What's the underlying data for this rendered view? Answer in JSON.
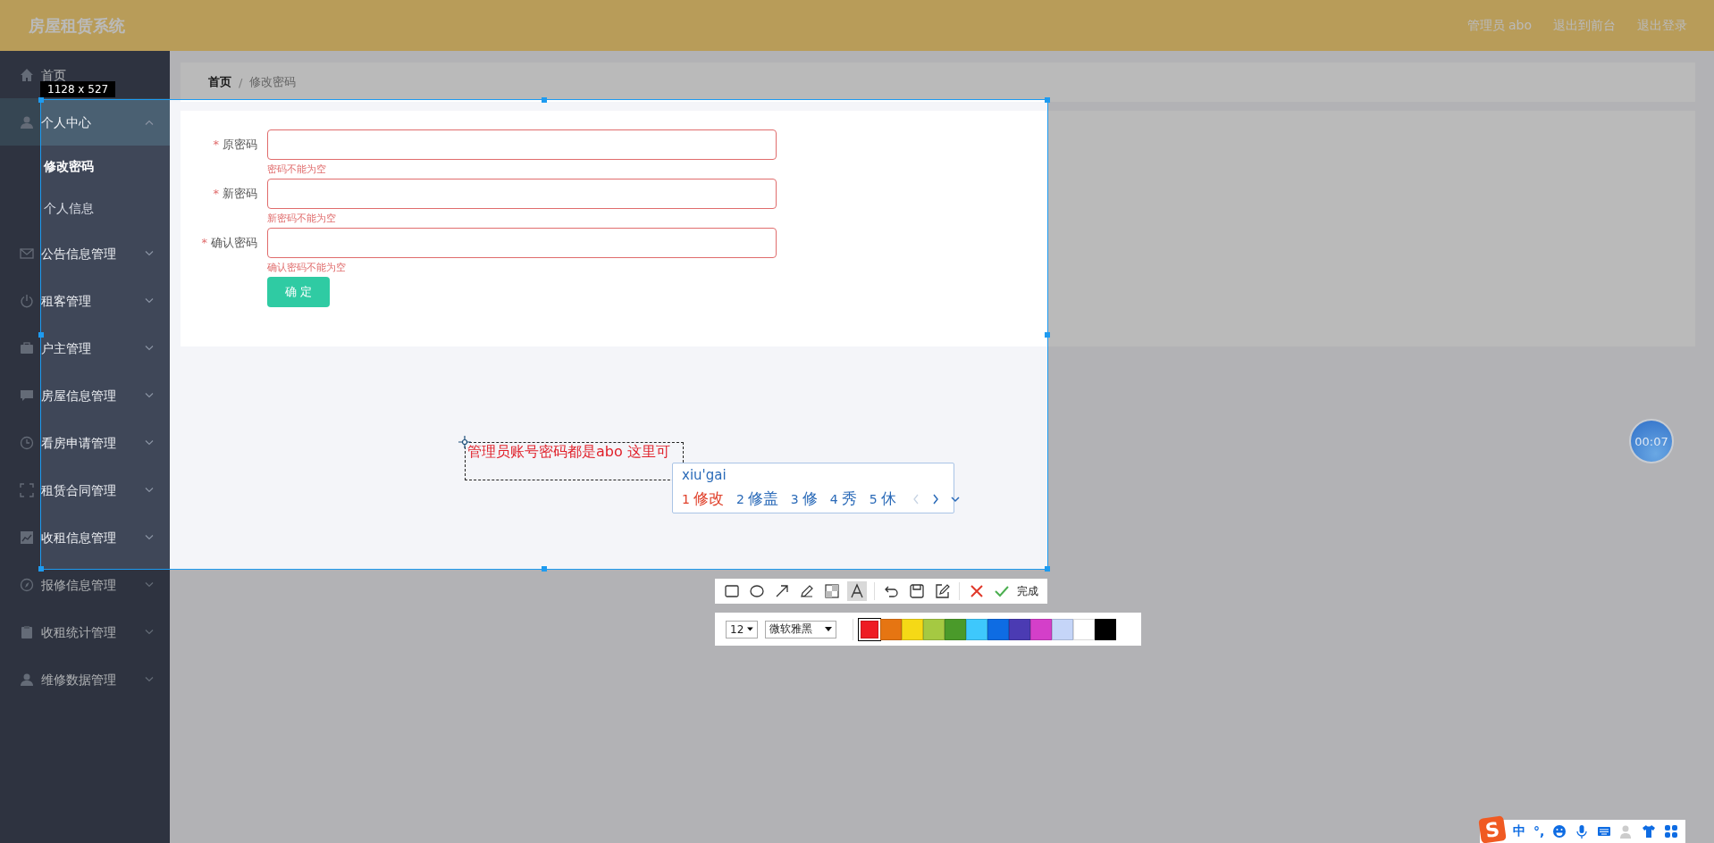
{
  "header": {
    "title": "房屋租赁系统",
    "links": [
      {
        "label": "管理员 abo"
      },
      {
        "label": "退出到前台"
      },
      {
        "label": "退出登录"
      }
    ]
  },
  "sidebar": {
    "items": [
      {
        "label": "首页"
      },
      {
        "label": "个人中心",
        "expanded": true,
        "children": [
          {
            "label": "修改密码",
            "selected": true
          },
          {
            "label": "个人信息",
            "selected": false
          }
        ]
      },
      {
        "label": "公告信息管理",
        "expanded": false
      },
      {
        "label": "租客管理",
        "expanded": false
      },
      {
        "label": "户主管理",
        "expanded": false
      },
      {
        "label": "房屋信息管理",
        "expanded": false
      },
      {
        "label": "看房申请管理",
        "expanded": false
      },
      {
        "label": "租赁合同管理",
        "expanded": false
      },
      {
        "label": "收租信息管理",
        "expanded": false
      },
      {
        "label": "报修信息管理",
        "expanded": false
      },
      {
        "label": "收租统计管理",
        "expanded": false
      },
      {
        "label": "维修数据管理",
        "expanded": false
      }
    ]
  },
  "breadcrumb": [
    {
      "label": "首页",
      "current": false,
      "kind": "link"
    },
    {
      "label": "/",
      "kind": "separator"
    },
    {
      "label": "修改密码",
      "current": true,
      "kind": "link"
    }
  ],
  "form": {
    "fields": [
      {
        "mark": "*",
        "label": "原密码",
        "invalid": true,
        "error": "密码不能为空"
      },
      {
        "mark": "*",
        "label": "新密码",
        "invalid": true,
        "error": "新密码不能为空"
      },
      {
        "mark": "*",
        "label": "确认密码",
        "invalid": true,
        "error": "确认密码不能为空"
      }
    ],
    "submit": "确 定"
  },
  "screenshot_tool": {
    "selection_size": "1128 x 527",
    "annotation": "管理员账号密码都是abo 这里可",
    "tools": [
      {
        "selected": false
      },
      {
        "selected": false
      },
      {
        "selected": false
      },
      {
        "selected": false
      },
      {
        "selected": false
      },
      {
        "selected": true
      },
      {
        "selected": false
      },
      {
        "selected": false
      },
      {
        "selected": false
      }
    ],
    "done": "完成",
    "font_size": "12",
    "font_name": "微软雅黑",
    "swatches": [
      {
        "color": "#ee1c24",
        "selected": true
      },
      {
        "color": "#e67512",
        "selected": false
      },
      {
        "color": "#f5d916",
        "selected": false
      },
      {
        "color": "#a5c942",
        "selected": false
      },
      {
        "color": "#4a9a2a",
        "selected": false
      },
      {
        "color": "#3ec8fc",
        "selected": false
      },
      {
        "color": "#0e6ce3",
        "selected": false
      },
      {
        "color": "#4b3bb3",
        "selected": false
      },
      {
        "color": "#d43fc9",
        "selected": false
      },
      {
        "color": "#c5d5f8",
        "selected": false
      },
      {
        "color": "#ffffff",
        "selected": false
      },
      {
        "color": "#000000",
        "selected": false
      }
    ]
  },
  "ime": {
    "composition": "xiu'gai",
    "candidates": [
      {
        "index": "1",
        "text": "修改",
        "selected": true
      },
      {
        "index": "2",
        "text": "修盖",
        "selected": false
      },
      {
        "index": "3",
        "text": "修",
        "selected": false
      },
      {
        "index": "4",
        "text": "秀",
        "selected": false
      },
      {
        "index": "5",
        "text": "休",
        "selected": false
      }
    ]
  },
  "timer": "00:07",
  "ime_bar": {
    "logo": "S",
    "mode": "中",
    "punctuation": "°,"
  }
}
